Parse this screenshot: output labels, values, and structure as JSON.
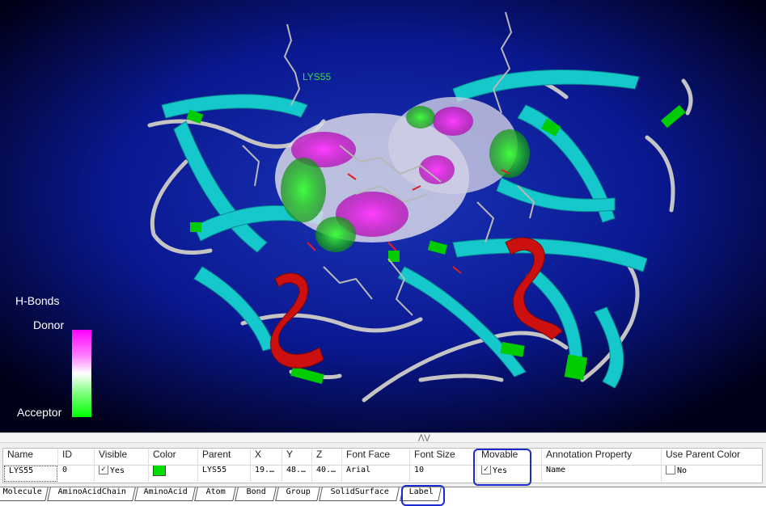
{
  "viewport": {
    "legend_title": "H-Bonds",
    "legend_donor": "Donor",
    "legend_acceptor": "Acceptor",
    "molecule_label": "LYS55",
    "colors": {
      "background": "#0a1890",
      "ribbon_strand": "#14c8cc",
      "ribbon_helix": "#cc1010",
      "ribbon_turn": "#00cc00",
      "coil": "#c8c8c8",
      "donor": "#ff00ff",
      "acceptor": "#00ff00"
    }
  },
  "splitter": {
    "grip": "⋀⋁"
  },
  "grid": {
    "columns": [
      "Name",
      "ID",
      "Visible",
      "Color",
      "Parent",
      "X",
      "Y",
      "Z",
      "Font Face",
      "Font Size",
      "Movable",
      "Annotation Property",
      "Use Parent Color"
    ],
    "row": {
      "name": "LYS55",
      "id": "0",
      "visible": "Yes",
      "color_hex": "#00dd00",
      "parent": "LYS55",
      "x": "19.…",
      "y": "48.…",
      "z": "40.…",
      "font_face": "Arial",
      "font_size": "10",
      "movable": "Yes",
      "annotation_property": "Name",
      "use_parent_color": "No"
    }
  },
  "tabs": [
    "Molecule",
    "AminoAcidChain",
    "AminoAcid",
    "Atom",
    "Bond",
    "Group",
    "SolidSurface",
    "Label"
  ],
  "active_tab": "Label"
}
